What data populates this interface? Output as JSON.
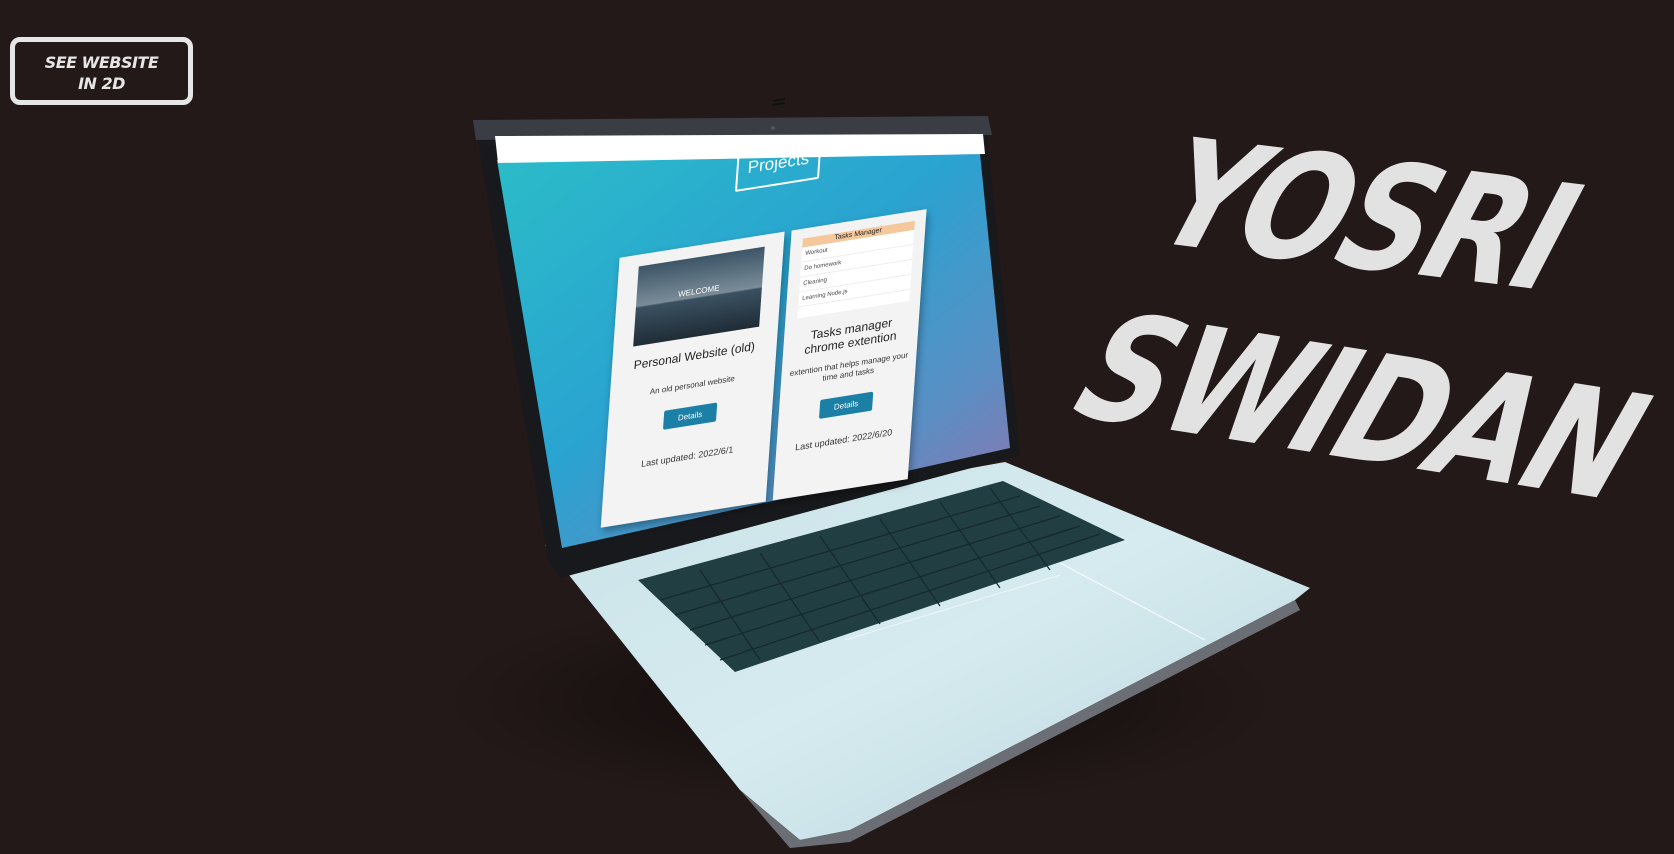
{
  "top_button": {
    "label": "SEE WEBSITE IN 2D"
  },
  "name": {
    "line1": "YOSRI",
    "line2": "SWIDAN"
  },
  "screen": {
    "title": "Projects",
    "cards": [
      {
        "thumb_text": "WELCOME",
        "title": "Personal Website (old)",
        "description": "An old personal website",
        "button": "Details",
        "updated": "Last updated: 2022/6/1"
      },
      {
        "thumb_header": "Tasks Manager",
        "thumb_tasks": [
          "Workout",
          "Do homework",
          "Cleaning",
          "Learning Node.js"
        ],
        "title": "Tasks manager chrome extention",
        "description": "extention that helps manage your time and tasks",
        "button": "Details",
        "updated": "Last updated: 2022/6/20"
      }
    ]
  },
  "colors": {
    "background": "#231918",
    "accent": "#1b7fa6",
    "name_text": "#e2e2e2"
  }
}
